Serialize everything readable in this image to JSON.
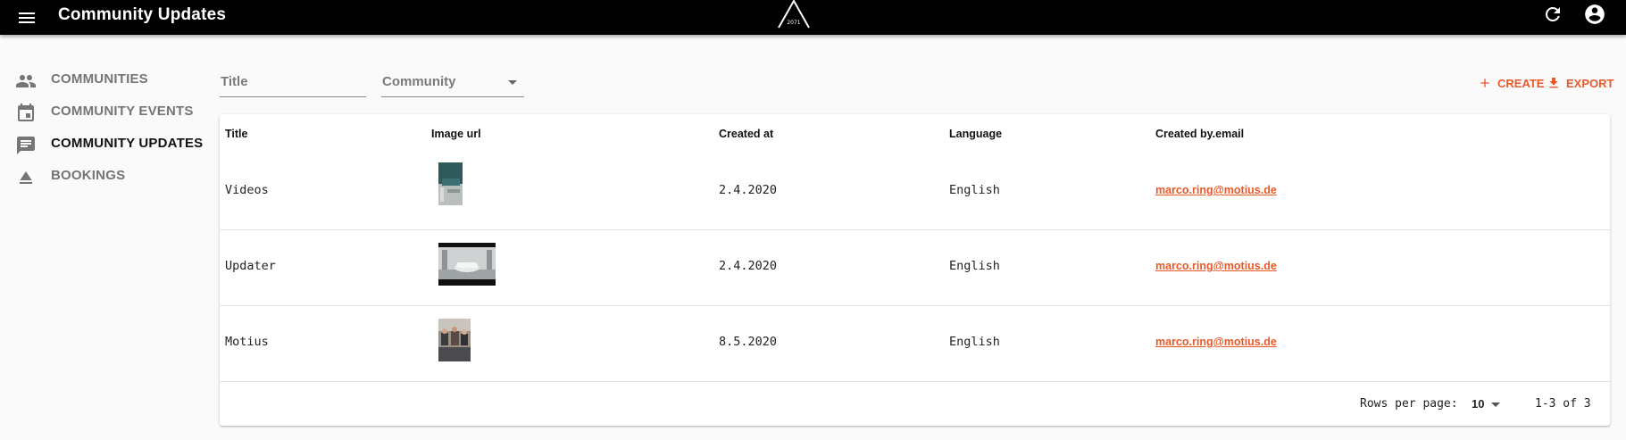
{
  "appbar": {
    "title": "Community Updates",
    "logo_text": "2071",
    "icons": [
      "menu-icon",
      "refresh-icon",
      "account-circle-icon"
    ]
  },
  "sidebar": {
    "items": [
      {
        "label": "COMMUNITIES",
        "icon": "people-icon",
        "active": false
      },
      {
        "label": "COMMUNITY EVENTS",
        "icon": "calendar-icon",
        "active": false
      },
      {
        "label": "COMMUNITY UPDATES",
        "icon": "chat-icon",
        "active": true
      },
      {
        "label": "BOOKINGS",
        "icon": "eject-icon",
        "active": false
      }
    ]
  },
  "filters": {
    "title_placeholder": "Title",
    "community_placeholder": "Community"
  },
  "actions": {
    "create_label": "CREATE",
    "export_label": "EXPORT"
  },
  "table": {
    "columns": [
      "Title",
      "Image url",
      "Created at",
      "Language",
      "Created by.email"
    ],
    "rows": [
      {
        "title": "Videos",
        "created_at": "2.4.2020",
        "language": "English",
        "email": "marco.ring@motius.de"
      },
      {
        "title": "Updater",
        "created_at": "2.4.2020",
        "language": "English",
        "email": "marco.ring@motius.de"
      },
      {
        "title": "Motius",
        "created_at": "8.5.2020",
        "language": "English",
        "email": "marco.ring@motius.de"
      }
    ]
  },
  "pagination": {
    "rows_per_page_label": "Rows per page:",
    "rows_per_page_value": "10",
    "range": "1-3 of 3"
  },
  "colors": {
    "accent": "#e8592a",
    "appbar": "#000000",
    "background": "#fafafa"
  }
}
